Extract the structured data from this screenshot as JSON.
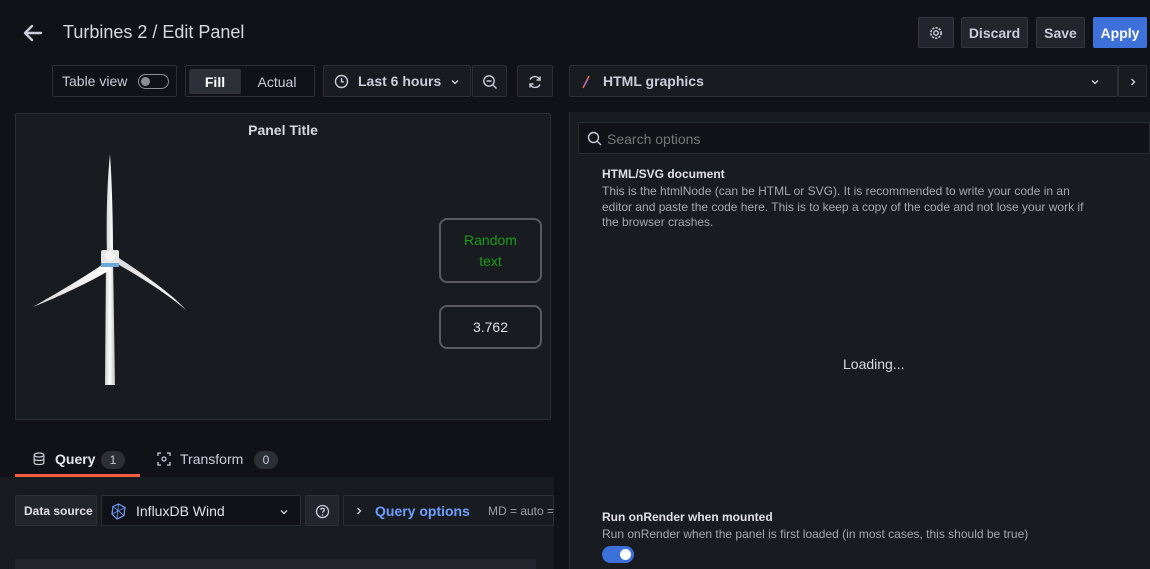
{
  "header": {
    "title": "Turbines 2 / Edit Panel",
    "discard_label": "Discard",
    "save_label": "Save",
    "apply_label": "Apply"
  },
  "toolbar": {
    "table_view_label": "Table view",
    "fill_label": "Fill",
    "actual_label": "Actual",
    "time_range": "Last 6 hours",
    "viz_picker_label": "HTML graphics"
  },
  "panel": {
    "title": "Panel Title",
    "random_text": "Random text",
    "value": "3.762"
  },
  "query_tabs": {
    "query_label": "Query",
    "query_count": "1",
    "transform_label": "Transform",
    "transform_count": "0"
  },
  "query_row": {
    "data_source_label": "Data source",
    "data_source_value": "InfluxDB Wind",
    "query_options_label": "Query options",
    "md_text": "MD = auto ="
  },
  "options": {
    "search_placeholder": "Search options",
    "html_doc_title": "HTML/SVG document",
    "html_doc_desc": "This is the htmlNode (can be HTML or SVG). It is recommended to write your code in an editor and paste the code here. This is to keep a copy of the code and not lose your work if the browser crashes.",
    "loading_text": "Loading...",
    "run_onrender_title": "Run onRender when mounted",
    "run_onrender_desc": "Run onRender when the panel is first loaded (in most cases, this should be true)",
    "run_onrender_enabled": true
  },
  "colors": {
    "accent": "#3d71d9",
    "query_tab_underline": "#f55f3e",
    "random_text": "#1a9c1a",
    "link": "#6e9fff"
  }
}
